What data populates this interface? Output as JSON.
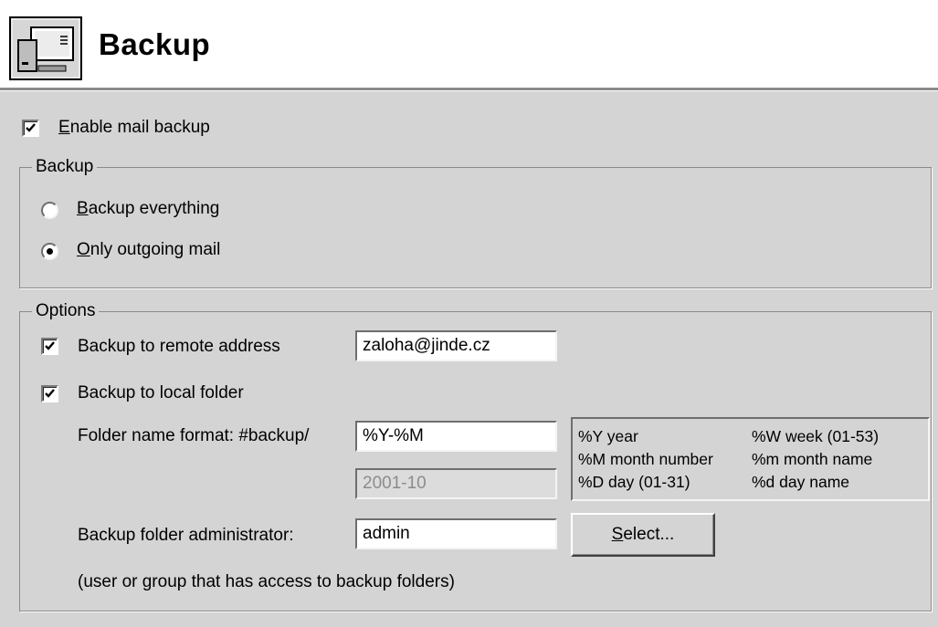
{
  "header": {
    "title": "Backup"
  },
  "enable_backup": {
    "label": "Enable mail backup",
    "checked": true
  },
  "backup_group": {
    "title": "Backup",
    "options": [
      {
        "label": "Backup everything",
        "selected": false
      },
      {
        "label": "Only outgoing mail",
        "selected": true
      }
    ]
  },
  "options_group": {
    "title": "Options",
    "remote": {
      "label": "Backup to remote address",
      "checked": true,
      "value": "zaloha@jinde.cz"
    },
    "local": {
      "label": "Backup to local folder",
      "checked": true
    },
    "folder_format": {
      "label": "Folder name format: #backup/",
      "value": "%Y-%M",
      "preview": "2001-10"
    },
    "format_help": [
      {
        "code": "%Y year",
        "code2": "%W week (01-53)"
      },
      {
        "code": "%M month number",
        "code2": "%m month name"
      },
      {
        "code": "%D  day (01-31)",
        "code2": "%d day name"
      }
    ],
    "admin": {
      "label": "Backup folder administrator:",
      "value": "admin",
      "select_label": "Select...",
      "note": "(user or group that has access to backup folders)"
    }
  }
}
